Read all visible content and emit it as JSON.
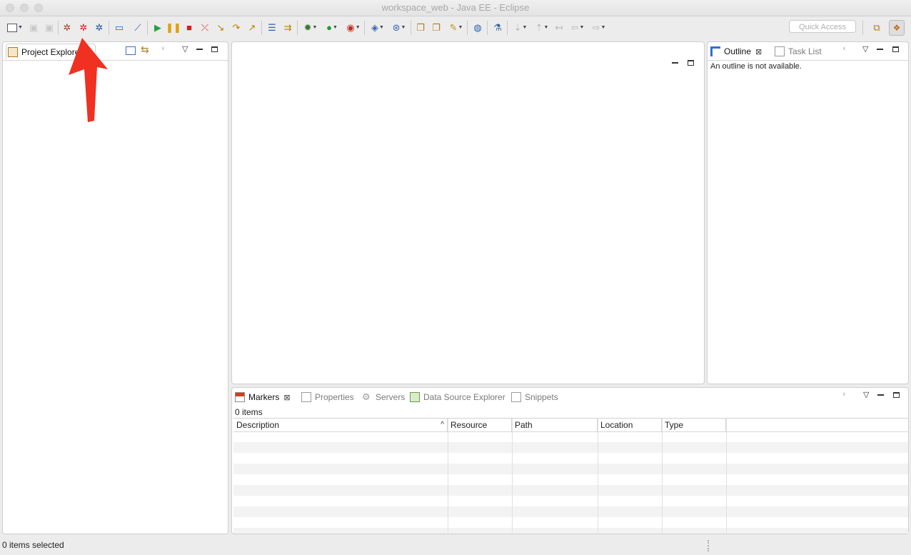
{
  "window": {
    "title": "workspace_web - Java EE - Eclipse"
  },
  "toolbar": {
    "quick_access": "Quick Access",
    "icons": [
      "new-wizard-icon",
      "save-icon",
      "save-all-icon",
      "debug-server-icon",
      "stop-server-icon",
      "publish-server-icon",
      "console-icon",
      "skip-breakpoints-icon",
      "resume-icon",
      "suspend-icon",
      "terminate-icon",
      "disconnect-icon",
      "step-into-icon",
      "step-over-icon",
      "step-return-icon",
      "drop-to-frame-icon",
      "use-step-filters-icon",
      "debug-icon",
      "run-icon",
      "run-on-server-icon",
      "new-server-icon",
      "new-class-icon",
      "open-type-icon",
      "open-task-icon",
      "search-icon",
      "open-web-browser-icon",
      "external-tools-icon",
      "next-annotation-icon",
      "previous-annotation-icon",
      "last-edit-location-icon",
      "back-icon",
      "forward-icon",
      "open-perspective-icon",
      "java-ee-perspective-icon"
    ]
  },
  "project_explorer": {
    "tab_label": "Project Explorer"
  },
  "outline": {
    "tab_label": "Outline",
    "task_list_label": "Task List",
    "message": "An outline is not available."
  },
  "bottom": {
    "tabs": [
      "Markers",
      "Properties",
      "Servers",
      "Data Source Explorer",
      "Snippets"
    ],
    "count": "0 items",
    "columns": [
      "Description",
      "Resource",
      "Path",
      "Location",
      "Type"
    ]
  },
  "status": {
    "text": "0 items selected"
  },
  "colors": {
    "arrow": "#f03020",
    "accent": "#2f6fd6"
  }
}
